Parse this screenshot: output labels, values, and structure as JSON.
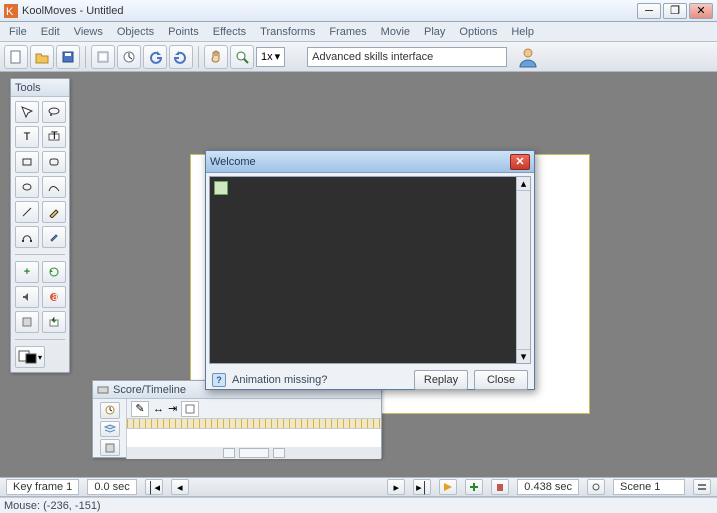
{
  "window": {
    "title": "KoolMoves - Untitled",
    "controls": {
      "minimize": "–",
      "maximize": "❐",
      "close": "✕"
    }
  },
  "menu": [
    "File",
    "Edit",
    "Views",
    "Objects",
    "Points",
    "Effects",
    "Transforms",
    "Frames",
    "Movie",
    "Play",
    "Options",
    "Help"
  ],
  "toolbar": {
    "zoom_value": "1x",
    "skills_text": "Advanced skills interface"
  },
  "tools_panel": {
    "title": "Tools"
  },
  "score_panel": {
    "title": "Score/Timeline"
  },
  "dialog": {
    "title": "Welcome",
    "hint": "Animation missing?",
    "replay": "Replay",
    "close": "Close"
  },
  "playbar": {
    "keyframe": "Key frame 1",
    "time_left": "0.0 sec",
    "time_right": "0.438 sec",
    "scene": "Scene 1"
  },
  "status": {
    "mouse": "Mouse: (-236, -151)"
  }
}
